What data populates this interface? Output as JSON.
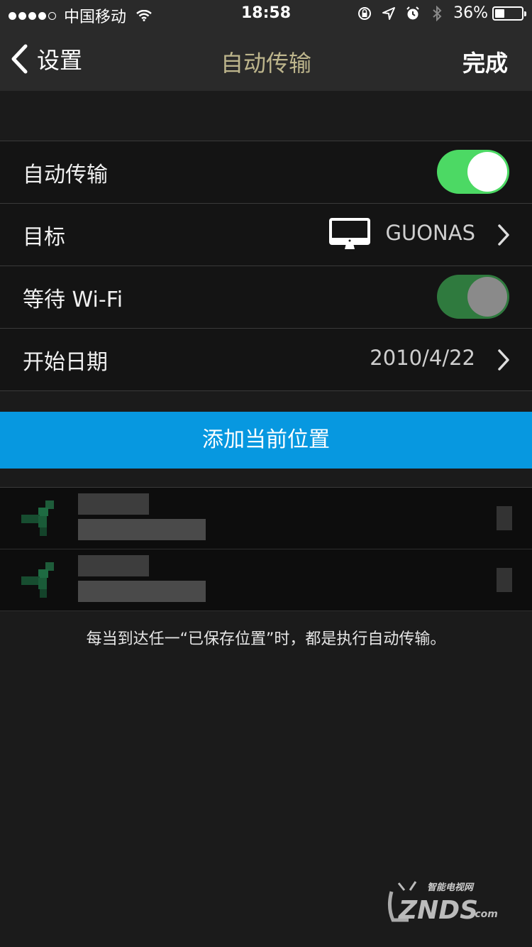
{
  "status_bar": {
    "carrier": "中国移动",
    "time": "18:58",
    "battery_percent": "36%",
    "battery_level": 0.36,
    "signal_dots": 5,
    "signal_filled": 4
  },
  "nav": {
    "back_label": "设置",
    "title": "自动传输",
    "done_label": "完成"
  },
  "settings": [
    {
      "label": "自动传输",
      "type": "toggle",
      "on": true,
      "color": "#4cd964"
    },
    {
      "label": "目标",
      "type": "value",
      "value": "GUONAS",
      "icon": "monitor-icon"
    },
    {
      "label": "等待 Wi-Fi",
      "type": "toggle",
      "on": true,
      "color": "#2f7a3e",
      "disabled": true
    },
    {
      "label": "开始日期",
      "type": "value",
      "value": "2010/4/22"
    }
  ],
  "add_location_label": "添加当前位置",
  "saved_places": [
    {
      "icon": "location-arrow-icon"
    },
    {
      "icon": "location-arrow-icon"
    }
  ],
  "footer_note": "每当到达任一“已保存位置”时，都是执行自动传输。",
  "colors": {
    "accent_blue": "#0798e0",
    "toggle_green": "#4cd964",
    "title_gold": "#bdb58c"
  },
  "watermark": {
    "text": "ZNDS",
    "sub": "智能电视网",
    "suffix": ".com"
  }
}
